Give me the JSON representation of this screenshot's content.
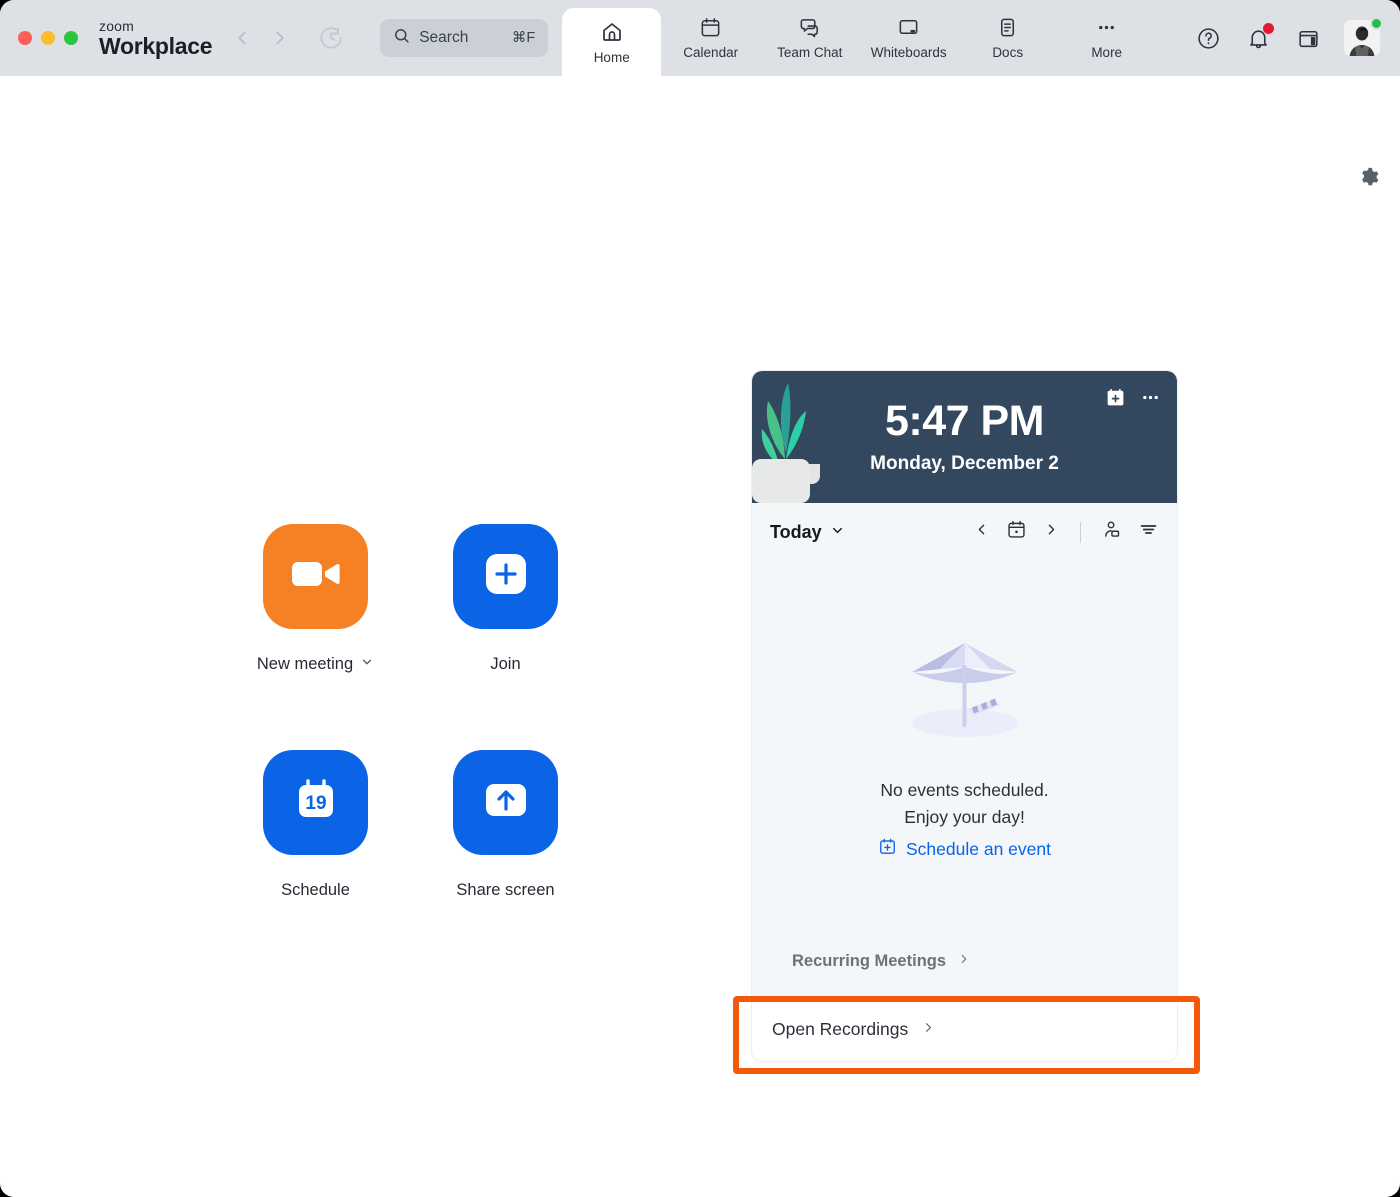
{
  "app": {
    "brand_line1": "zoom",
    "brand_line2": "Workplace"
  },
  "titlebar": {
    "search": {
      "placeholder": "Search",
      "shortcut": "⌘F"
    },
    "nav": {
      "back": "Back",
      "forward": "Forward",
      "history": "History"
    },
    "tabs": [
      {
        "label": "Home",
        "icon": "home-icon",
        "active": true
      },
      {
        "label": "Calendar",
        "icon": "calendar-icon",
        "active": false
      },
      {
        "label": "Team Chat",
        "icon": "chat-bubbles-icon",
        "active": false
      },
      {
        "label": "Whiteboards",
        "icon": "whiteboard-icon",
        "active": false
      },
      {
        "label": "Docs",
        "icon": "doc-icon",
        "active": false
      },
      {
        "label": "More",
        "icon": "ellipsis-icon",
        "active": false
      }
    ],
    "right_icons": [
      {
        "name": "help-icon",
        "label": "Help"
      },
      {
        "name": "bell-icon",
        "label": "Notifications",
        "badge": true
      },
      {
        "name": "calendar-mini-icon",
        "label": "Calendar"
      }
    ],
    "avatar": {
      "name": "avatar",
      "status": "available",
      "status_color": "#21c04a"
    }
  },
  "body": {
    "settings_icon": "gear-icon"
  },
  "actions": [
    {
      "id": "new-meeting",
      "label": "New meeting",
      "icon": "video-camera-icon",
      "color": "#f68024",
      "has_caret": true
    },
    {
      "id": "join",
      "label": "Join",
      "icon": "plus-square-icon",
      "color": "#0b63e5",
      "has_caret": false
    },
    {
      "id": "schedule",
      "label": "Schedule",
      "icon": "calendar-19-icon",
      "color": "#0b63e5",
      "has_caret": false,
      "day_number": "19"
    },
    {
      "id": "share-screen",
      "label": "Share screen",
      "icon": "up-arrow-screen-icon",
      "color": "#0b63e5",
      "has_caret": false
    }
  ],
  "panel": {
    "time": "5:47 PM",
    "date": "Monday, December 2",
    "card_icons": [
      {
        "name": "calendar-add-icon"
      },
      {
        "name": "more-options-icon"
      }
    ],
    "toolbar": {
      "today_label": "Today",
      "today_caret": "chevron-down-icon",
      "prev": "chevron-left-icon",
      "date_picker": "calendar-dot-icon",
      "next": "chevron-right-icon",
      "contacts": "contact-card-icon",
      "filter": "filter-icon"
    },
    "empty_state": {
      "illustration": "beach-umbrella-illustration",
      "line1": "No events scheduled.",
      "line2": "Enjoy your day!",
      "link_label": "Schedule an event",
      "link_icon": "calendar-add-icon",
      "link_color": "#0b63e5"
    },
    "recurring": {
      "label": "Recurring Meetings",
      "icon": "chevron-right-icon"
    },
    "footer": {
      "label": "Open Recordings",
      "icon": "chevron-right-icon"
    }
  },
  "highlight": {
    "color": "#f4590b",
    "target": "open-recordings-row"
  }
}
